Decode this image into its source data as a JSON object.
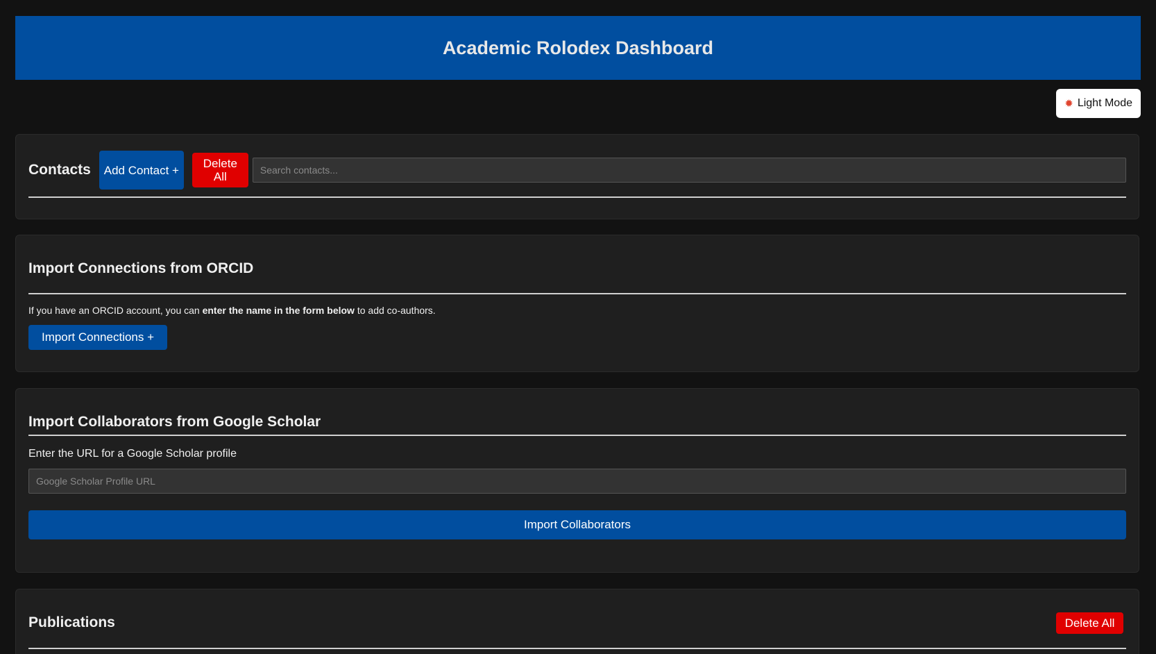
{
  "header": {
    "title": "Academic Rolodex Dashboard"
  },
  "mode_toggle": {
    "icon": "sun-icon",
    "label": "Light Mode"
  },
  "contacts": {
    "title": "Contacts",
    "add_label": "Add Contact +",
    "delete_all_label": "Delete All",
    "search_placeholder": "Search contacts...",
    "search_value": ""
  },
  "orcid": {
    "title": "Import Connections from ORCID",
    "desc_prefix": "If you have an ORCID account, you can ",
    "desc_bold": "enter the name in the form below",
    "desc_suffix": " to add co-authors.",
    "button_label": "Import Connections +"
  },
  "scholar": {
    "title": "Import Collaborators from Google Scholar",
    "label": "Enter the URL for a Google Scholar profile",
    "input_placeholder": "Google Scholar Profile URL",
    "input_value": "",
    "button_label": "Import Collaborators"
  },
  "publications": {
    "title": "Publications",
    "delete_all_label": "Delete All"
  },
  "colors": {
    "background": "#121212",
    "card": "#1f1f1f",
    "primary_blue": "#014e9f",
    "danger_red": "#e00000"
  }
}
